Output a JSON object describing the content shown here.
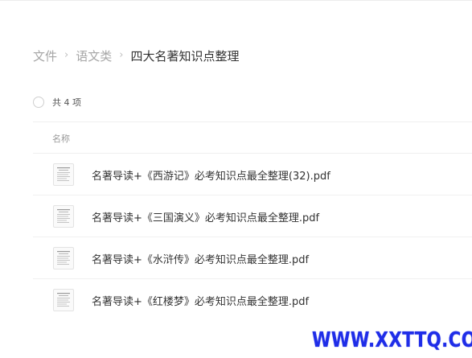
{
  "breadcrumb": {
    "items": [
      "文件",
      "语文类"
    ],
    "separator": "›",
    "current": "四大名著知识点整理"
  },
  "summary": {
    "count_label": "共 4 项"
  },
  "table": {
    "column_name": "名称"
  },
  "files": [
    {
      "name": "名著导读+《西游记》必考知识点最全整理(32).pdf",
      "icon": "pdf-thumbnail-icon"
    },
    {
      "name": "名著导读+《三国演义》必考知识点最全整理.pdf",
      "icon": "pdf-thumbnail-icon"
    },
    {
      "name": "名著导读+《水浒传》必考知识点最全整理.pdf",
      "icon": "pdf-thumbnail-icon"
    },
    {
      "name": "名著导读+《红楼梦》必考知识点最全整理.pdf",
      "icon": "pdf-thumbnail-icon"
    }
  ],
  "watermark": {
    "text": "WWW.XXTTQ.COM",
    "color": "#1f2de8"
  }
}
